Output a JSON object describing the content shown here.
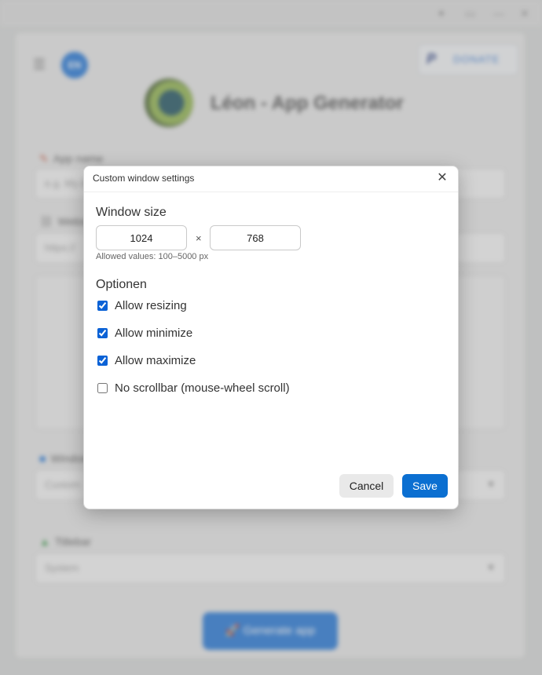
{
  "app": {
    "language_badge": "EN",
    "donate_label": "DONATE",
    "title": "Léon - App Generator",
    "app_name_label": "App name",
    "app_name_placeholder": "e.g. My App",
    "website_label": "Website",
    "website_placeholder": "https://",
    "window_label": "Window",
    "window_value": "Custom",
    "titlebar_label": "Titlebar",
    "titlebar_value": "System",
    "generate_label": "🚀 Generate app"
  },
  "dialog": {
    "title": "Custom window settings",
    "close_icon": "close-icon",
    "window_size_heading": "Window size",
    "width_value": "1024",
    "height_value": "768",
    "times_symbol": "×",
    "hint": "Allowed values: 100–5000 px",
    "options_heading": "Optionen",
    "options": [
      {
        "label": "Allow resizing",
        "checked": true
      },
      {
        "label": "Allow minimize",
        "checked": true
      },
      {
        "label": "Allow maximize",
        "checked": true
      },
      {
        "label": "No scrollbar (mouse-wheel scroll)",
        "checked": false
      }
    ],
    "cancel_label": "Cancel",
    "save_label": "Save"
  },
  "colors": {
    "primary": "#0b6fd1",
    "cancel_bg": "#e9e9e9",
    "checkbox": "#0b62d6"
  }
}
